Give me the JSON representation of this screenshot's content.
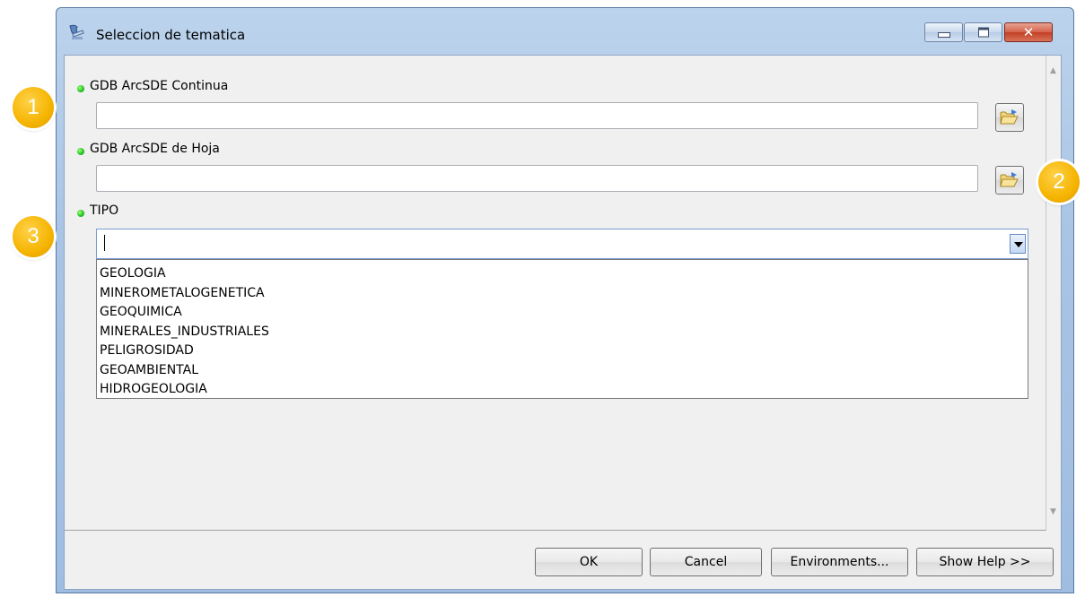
{
  "window": {
    "title": "Seleccion de tematica"
  },
  "params": [
    {
      "label": "GDB ArcSDE Continua",
      "value": ""
    },
    {
      "label": "GDB ArcSDE de Hoja",
      "value": ""
    },
    {
      "label": "TIPO",
      "value": ""
    }
  ],
  "dropdown": {
    "options": [
      "GEOLOGIA",
      "MINEROMETALOGENETICA",
      "GEOQUIMICA",
      "MINERALES_INDUSTRIALES",
      "PELIGROSIDAD",
      "GEOAMBIENTAL",
      "HIDROGEOLOGIA"
    ]
  },
  "buttons": {
    "ok": "OK",
    "cancel": "Cancel",
    "environments": "Environments...",
    "help": "Show Help >>"
  },
  "callouts": [
    "1",
    "2",
    "3"
  ],
  "icons": {
    "app": "tool-dialog-icon",
    "browse": "folder-open-icon",
    "required": "green-dot-icon"
  },
  "colors": {
    "callout": "#f5b400",
    "required_dot": "#20c020",
    "close_button": "#c23f24"
  }
}
